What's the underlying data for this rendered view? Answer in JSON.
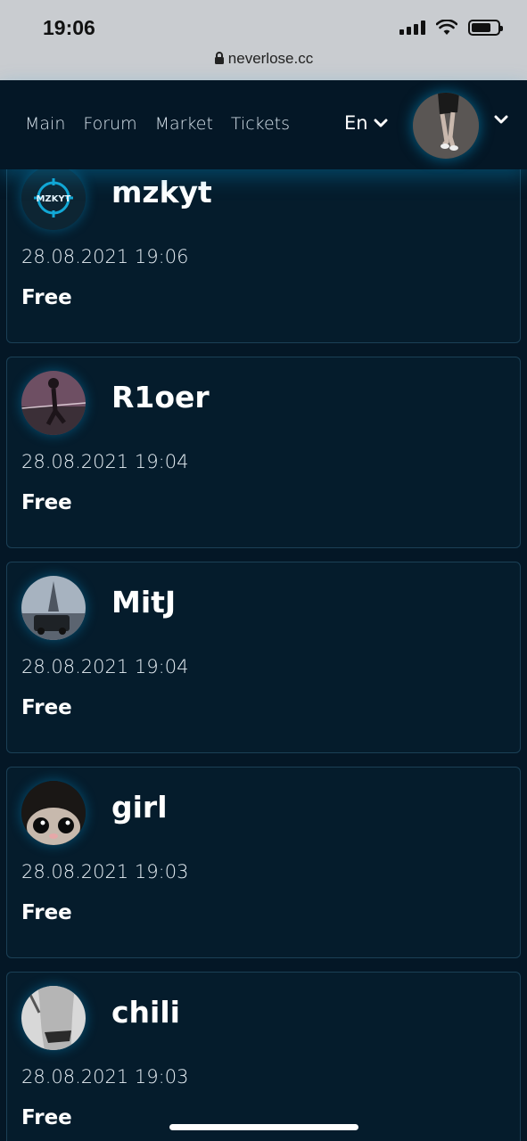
{
  "status_bar": {
    "time": "19:06",
    "url": "neverlose.cc"
  },
  "nav": {
    "links": [
      "Main",
      "Forum",
      "Market",
      "Tickets"
    ],
    "language": "En",
    "icons": {
      "language_chevron": "chevron-down-icon",
      "profile_chevron": "chevron-down-icon"
    }
  },
  "cards": [
    {
      "name": "mzkyt",
      "date": "28.08.2021 19:06",
      "status": "Free",
      "avatar_logo_text": "MZKYT"
    },
    {
      "name": "R1oer",
      "date": "28.08.2021 19:04",
      "status": "Free"
    },
    {
      "name": "MitJ",
      "date": "28.08.2021 19:04",
      "status": "Free"
    },
    {
      "name": "girl",
      "date": "28.08.2021 19:03",
      "status": "Free"
    },
    {
      "name": "chili",
      "date": "28.08.2021 19:03",
      "status": "Free"
    }
  ],
  "colors": {
    "page_background": "#041726",
    "card_background": "#051c2c",
    "card_border": "#1b4056",
    "accent_glow": "#00aae6"
  }
}
